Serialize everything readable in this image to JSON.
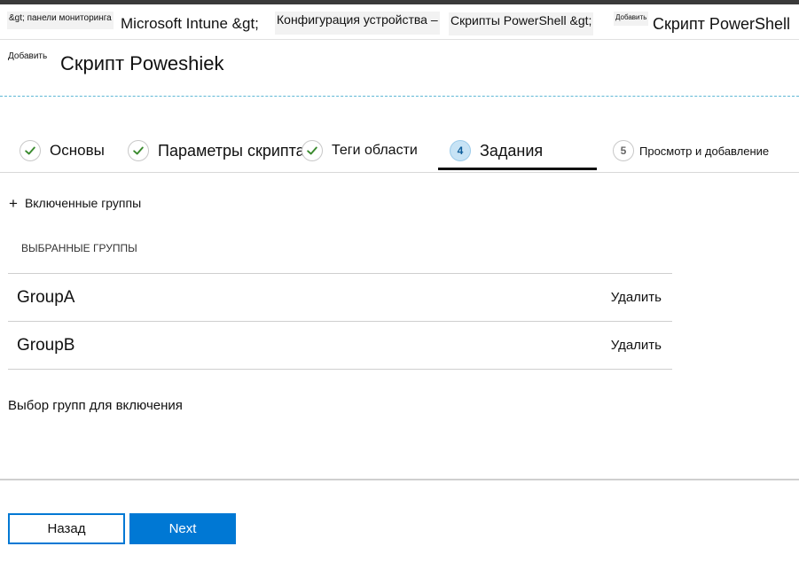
{
  "breadcrumb": {
    "items": [
      "&gt; панели мониторинга",
      "Microsoft Intune &gt;",
      "Конфигурация устройства –",
      "Скрипты PowerShell &gt;",
      "Добавить",
      "Скрипт PowerShell"
    ]
  },
  "header": {
    "prefix": "Добавить",
    "title": "Скрипт Poweshiek"
  },
  "wizard": {
    "steps": [
      {
        "label": "Основы",
        "state": "done"
      },
      {
        "label": "Параметры скрипта",
        "state": "done"
      },
      {
        "label": "Теги области",
        "state": "done"
      },
      {
        "number": "4",
        "label": "Задания",
        "state": "active"
      },
      {
        "number": "5",
        "label": "Просмотр и добавление",
        "state": "todo"
      }
    ]
  },
  "included": {
    "add_label": "Включенные группы",
    "selected_header": "ВЫБРАННЫЕ ГРУППЫ",
    "groups": [
      {
        "name": "GroupA",
        "action": "Удалить"
      },
      {
        "name": "GroupB",
        "action": "Удалить"
      }
    ],
    "select_link": "Выбор групп для включения"
  },
  "footer": {
    "back_label": "Назад",
    "next_label": "Next"
  },
  "colors": {
    "accent": "#0078d4",
    "check": "#3a8a2e",
    "active_step": "#c7e3f5",
    "dashed": "#5fb8d6"
  }
}
